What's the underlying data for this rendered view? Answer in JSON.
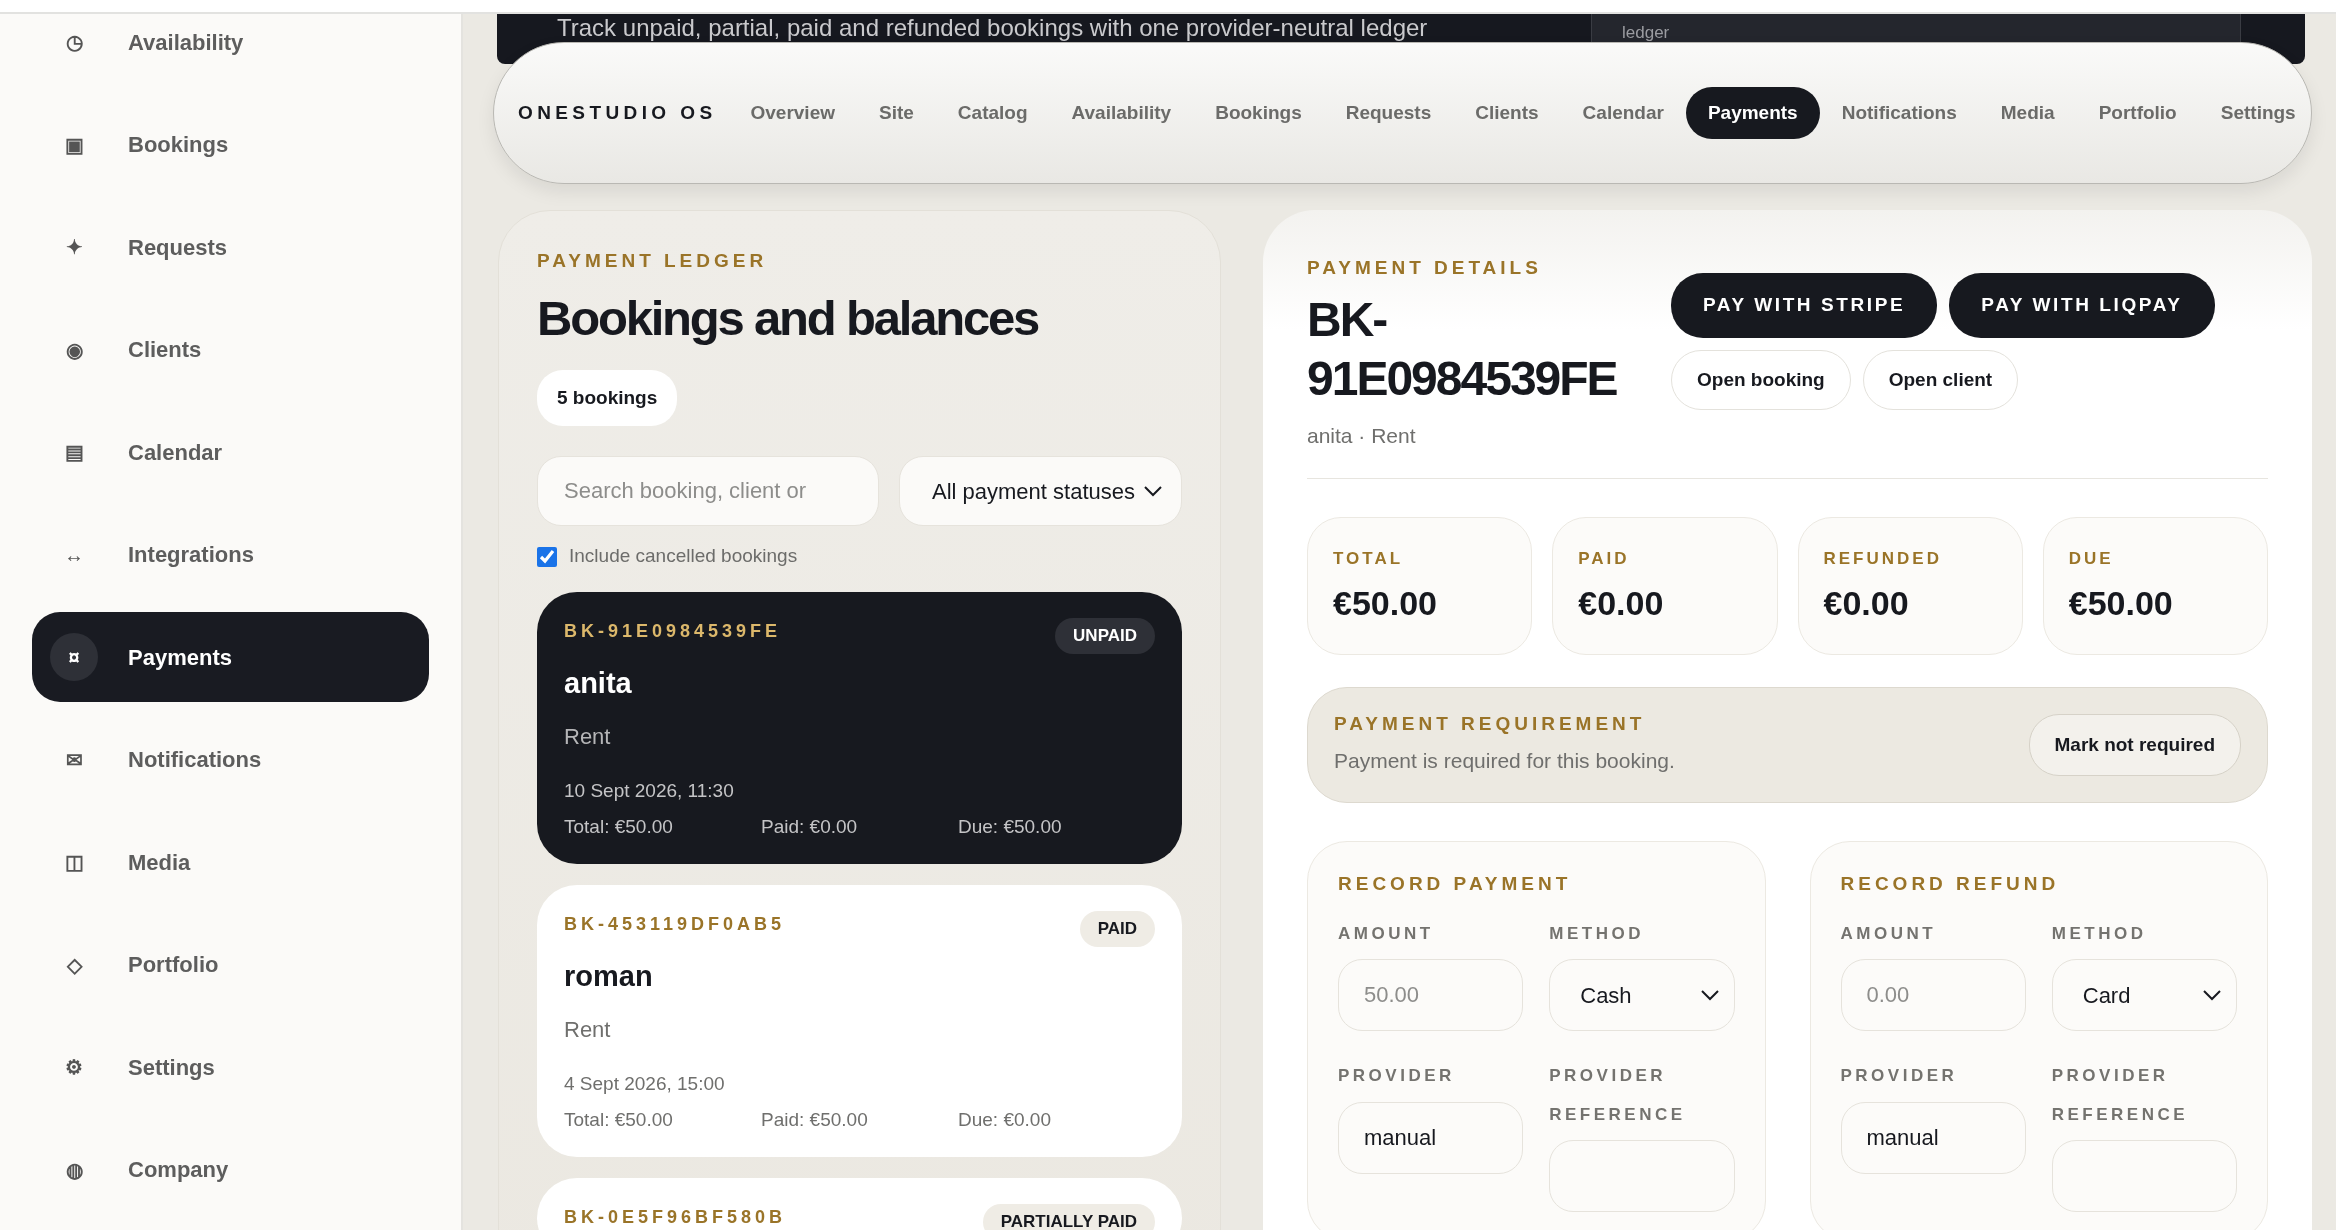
{
  "sidebar": {
    "items": [
      {
        "icon": "◷",
        "label": "Availability",
        "selected": false
      },
      {
        "icon": "▣",
        "label": "Bookings",
        "selected": false
      },
      {
        "icon": "✦",
        "label": "Requests",
        "selected": false
      },
      {
        "icon": "◉",
        "label": "Clients",
        "selected": false
      },
      {
        "icon": "▤",
        "label": "Calendar",
        "selected": false
      },
      {
        "icon": "↔",
        "label": "Integrations",
        "selected": false
      },
      {
        "icon": "¤",
        "label": "Payments",
        "selected": true
      },
      {
        "icon": "✉",
        "label": "Notifications",
        "selected": false
      },
      {
        "icon": "◫",
        "label": "Media",
        "selected": false
      },
      {
        "icon": "◇",
        "label": "Portfolio",
        "selected": false
      },
      {
        "icon": "⚙",
        "label": "Settings",
        "selected": false
      },
      {
        "icon": "◍",
        "label": "Company",
        "selected": false
      }
    ]
  },
  "hero": {
    "subtitle": "Track unpaid, partial, paid and refunded bookings with one provider-neutral ledger",
    "side_text": "ledger"
  },
  "topnav": {
    "brand": "ONESTUDIO OS",
    "items": [
      {
        "label": "Overview",
        "selected": false
      },
      {
        "label": "Site",
        "selected": false
      },
      {
        "label": "Catalog",
        "selected": false
      },
      {
        "label": "Availability",
        "selected": false
      },
      {
        "label": "Bookings",
        "selected": false
      },
      {
        "label": "Requests",
        "selected": false
      },
      {
        "label": "Clients",
        "selected": false
      },
      {
        "label": "Calendar",
        "selected": false
      },
      {
        "label": "Payments",
        "selected": true
      },
      {
        "label": "Notifications",
        "selected": false
      },
      {
        "label": "Media",
        "selected": false
      },
      {
        "label": "Portfolio",
        "selected": false
      },
      {
        "label": "Settings",
        "selected": false
      }
    ]
  },
  "ledger": {
    "eyebrow": "PAYMENT LEDGER",
    "title": "Bookings and balances",
    "count": "5 bookings",
    "search": {
      "placeholder": "Search booking, client or"
    },
    "status_filter": {
      "value": "All payment statuses"
    },
    "include_cancelled": {
      "label": "Include cancelled bookings",
      "checked": true
    },
    "bookings": [
      {
        "id": "BK-91E0984539FE",
        "status": "UNPAID",
        "selected": true,
        "client": "anita",
        "service": "Rent",
        "date": "10 Sept 2026, 11:30",
        "total": "Total: €50.00",
        "paid": "Paid: €0.00",
        "due": "Due: €50.00"
      },
      {
        "id": "BK-453119DF0AB5",
        "status": "PAID",
        "selected": false,
        "client": "roman",
        "service": "Rent",
        "date": "4 Sept 2026, 15:00",
        "total": "Total: €50.00",
        "paid": "Paid: €50.00",
        "due": "Due: €0.00"
      },
      {
        "id": "BK-0E5F96BF580B",
        "status": "PARTIALLY PAID",
        "selected": false
      }
    ]
  },
  "details": {
    "eyebrow": "PAYMENT DETAILS",
    "title": "BK-91E0984539FE",
    "subtitle": "anita · Rent",
    "actions": [
      {
        "label": "PAY WITH STRIPE",
        "kind": "primary"
      },
      {
        "label": "PAY WITH LIQPAY",
        "kind": "primary"
      },
      {
        "label": "Open booking",
        "kind": "outline"
      },
      {
        "label": "Open client",
        "kind": "outline"
      }
    ],
    "stats": [
      {
        "label": "TOTAL",
        "value": "€50.00"
      },
      {
        "label": "PAID",
        "value": "€0.00"
      },
      {
        "label": "REFUNDED",
        "value": "€0.00"
      },
      {
        "label": "DUE",
        "value": "€50.00"
      }
    ],
    "requirement": {
      "eyebrow": "PAYMENT REQUIREMENT",
      "text": "Payment is required for this booking.",
      "button": "Mark not required"
    },
    "forms": [
      {
        "title": "RECORD PAYMENT",
        "fields": [
          {
            "label": "AMOUNT",
            "kind": "input",
            "placeholder": "50.00"
          },
          {
            "label": "METHOD",
            "kind": "select",
            "value": "Cash"
          },
          {
            "label": "PROVIDER",
            "kind": "input",
            "value": "manual"
          },
          {
            "label": "PROVIDER REFERENCE",
            "kind": "input"
          }
        ]
      },
      {
        "title": "RECORD REFUND",
        "fields": [
          {
            "label": "AMOUNT",
            "kind": "input",
            "placeholder": "0.00"
          },
          {
            "label": "METHOD",
            "kind": "select",
            "value": "Card"
          },
          {
            "label": "PROVIDER",
            "kind": "input",
            "value": "manual"
          },
          {
            "label": "PROVIDER REFERENCE",
            "kind": "input"
          }
        ]
      }
    ]
  }
}
